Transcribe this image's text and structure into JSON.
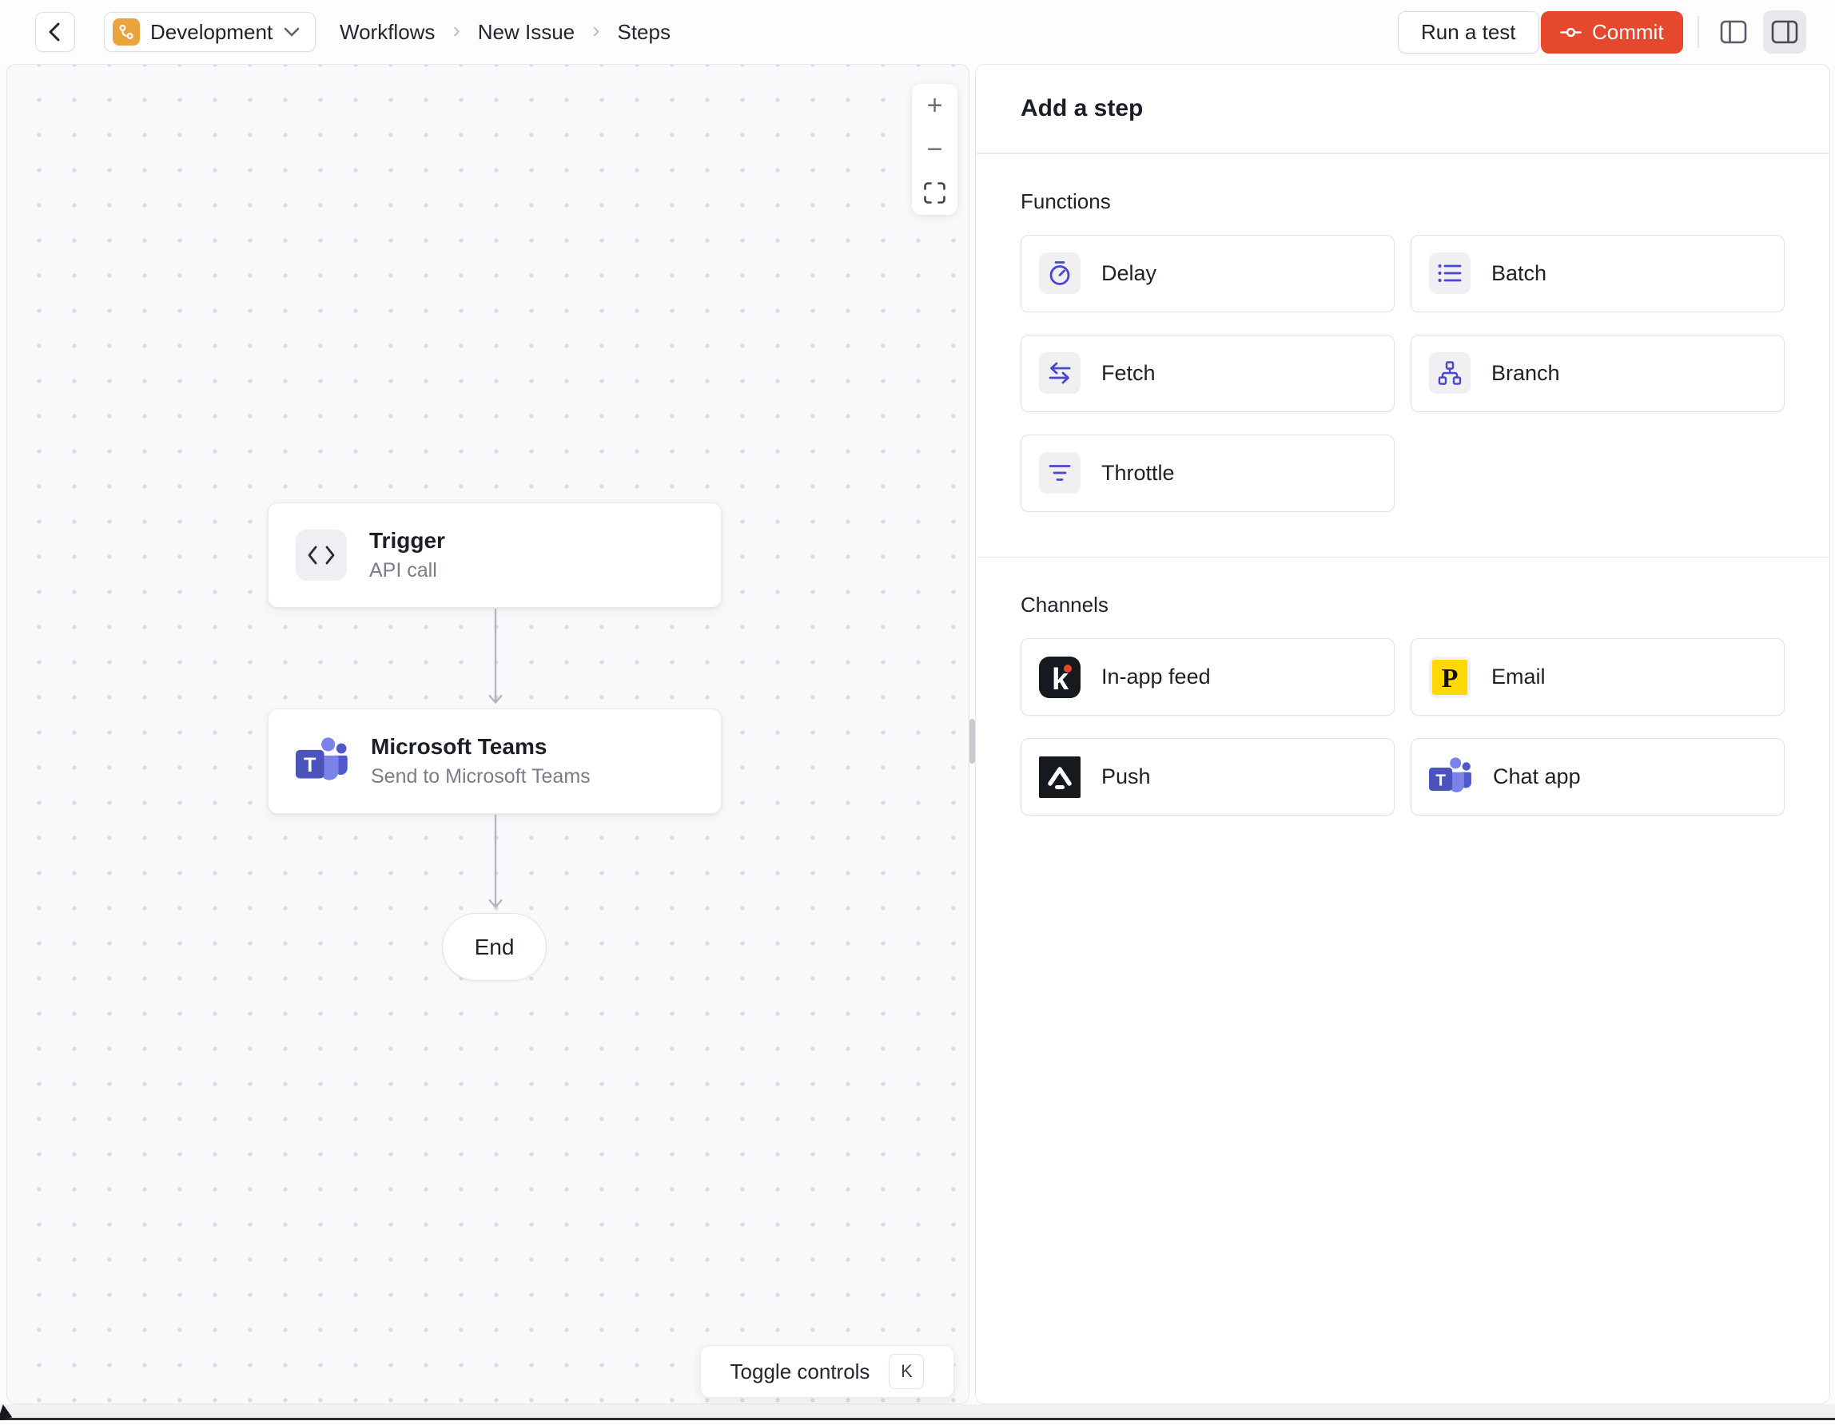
{
  "topbar": {
    "environment": {
      "label": "Development"
    },
    "breadcrumb": {
      "items": [
        "Workflows",
        "New Issue",
        "Steps"
      ],
      "separator": "›"
    },
    "run_test_label": "Run a test",
    "commit_label": "Commit"
  },
  "canvas": {
    "zoom_in_label": "+",
    "zoom_out_label": "−",
    "nodes": [
      {
        "title": "Trigger",
        "subtitle": "API call",
        "icon": "code-icon"
      },
      {
        "title": "Microsoft Teams",
        "subtitle": "Send to Microsoft Teams",
        "icon": "microsoft-teams-icon"
      }
    ],
    "end_label": "End",
    "toggle_controls": {
      "label": "Toggle controls",
      "shortcut": "K"
    }
  },
  "side_panel": {
    "title": "Add a step",
    "sections": [
      {
        "label": "Functions",
        "items": [
          {
            "label": "Delay",
            "icon": "stopwatch-icon"
          },
          {
            "label": "Batch",
            "icon": "list-icon"
          },
          {
            "label": "Fetch",
            "icon": "swap-arrows-icon"
          },
          {
            "label": "Branch",
            "icon": "hierarchy-icon"
          },
          {
            "label": "Throttle",
            "icon": "funnel-icon"
          }
        ]
      },
      {
        "label": "Channels",
        "items": [
          {
            "label": "In-app feed",
            "icon": "knock-icon"
          },
          {
            "label": "Email",
            "icon": "postmark-icon"
          },
          {
            "label": "Push",
            "icon": "expo-icon"
          },
          {
            "label": "Chat app",
            "icon": "microsoft-teams-icon"
          }
        ]
      }
    ]
  },
  "colors": {
    "accent_indigo": "#4946D0",
    "commit_orange": "#E5482C",
    "environment_badge_orange": "#EBA33C",
    "email_yellow": "#FFD900",
    "dark_icon": "#16191D",
    "teams_purple": "#4B53BC"
  }
}
